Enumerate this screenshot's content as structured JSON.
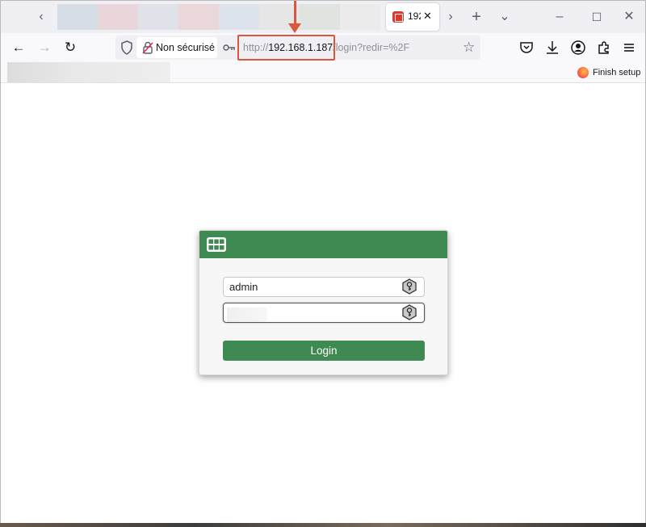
{
  "browser": {
    "active_tab": {
      "title": "192",
      "close_glyph": "✕"
    },
    "tab_controls": {
      "scroll_left": "‹",
      "scroll_right": "›",
      "new_tab": "+",
      "list_all": "⌄"
    },
    "window_controls": {
      "minimize": "–",
      "maximize": "☐",
      "close": "✕"
    },
    "nav": {
      "back": "←",
      "forward": "→",
      "reload": "↻"
    },
    "security_label": "Non sécurisé",
    "url": {
      "scheme": "http://",
      "host": "192.168.1.187",
      "path": "/login?redir=%2F"
    },
    "bookmark_star": "☆",
    "finish_setup": "Finish setup"
  },
  "login": {
    "username_value": "admin",
    "password_value": "",
    "button_label": "Login"
  },
  "colors": {
    "accent_green": "#3f8a52",
    "annotation_red": "#d9573d",
    "tab_favicon_red": "#d93a2b"
  },
  "icons": {
    "shield": "shield-icon",
    "lock": "lock-warning-icon",
    "key": "key-icon",
    "star": "star-icon",
    "pocket": "pocket-icon",
    "download": "download-icon",
    "account": "account-icon",
    "extensions": "extensions-icon",
    "menu": "menu-icon",
    "fortinet": "fortinet-logo",
    "password_manager": "key-hex-icon"
  }
}
